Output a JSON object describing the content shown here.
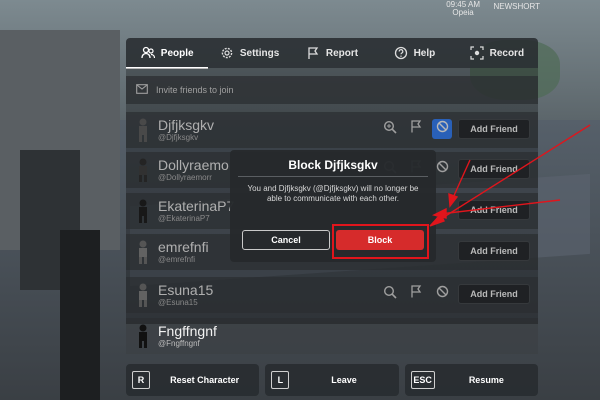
{
  "status_bar": {
    "time": "09:45 AM",
    "sub": "Opeia",
    "right": "NEWSHORT"
  },
  "tabs": [
    {
      "label": "People",
      "icon": "people-icon",
      "active": true
    },
    {
      "label": "Settings",
      "icon": "gear-icon"
    },
    {
      "label": "Report",
      "icon": "flag-icon"
    },
    {
      "label": "Help",
      "icon": "help-icon"
    },
    {
      "label": "Record",
      "icon": "record-icon"
    }
  ],
  "invite": {
    "label": "Invite friends to join",
    "icon": "mail-icon"
  },
  "players": [
    {
      "display_name": "Djfjksgkv",
      "username": "@Djfjksgkv",
      "add_label": "Add Friend",
      "blocked_highlight": true
    },
    {
      "display_name": "Dollyraemo",
      "username": "@Dollyraemorr",
      "add_label": "Add Friend"
    },
    {
      "display_name": "EkaterinaP7",
      "username": "@EkaterinaP7",
      "add_label": "Add Friend"
    },
    {
      "display_name": "emrefnfi",
      "username": "@emrefnfi",
      "add_label": "Add Friend"
    },
    {
      "display_name": "Esuna15",
      "username": "@Esuna15",
      "add_label": "Add Friend"
    },
    {
      "display_name": "Fngffngnf",
      "username": "@Fngffngnf",
      "add_label": ""
    }
  ],
  "bottom_bar": [
    {
      "key": "R",
      "label": "Reset Character"
    },
    {
      "key": "L",
      "label": "Leave"
    },
    {
      "key": "ESC",
      "label": "Resume"
    }
  ],
  "dialog": {
    "title": "Block Djfjksgkv",
    "message": "You and Djfjksgkv (@Djfjksgkv) will no longer be able to communicate with each other.",
    "cancel_label": "Cancel",
    "block_label": "Block"
  },
  "colors": {
    "accent_blue": "#3a86ff",
    "block_red": "#d62b2b",
    "annotation_red": "#e0151c"
  }
}
